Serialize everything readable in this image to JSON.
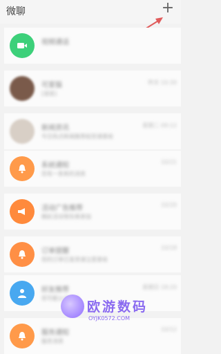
{
  "header": {
    "title": "微聊",
    "add_icon": "plus-icon",
    "add_label": "+"
  },
  "annotation": {
    "arrow_color": "#e05a5a"
  },
  "chat_list": [
    {
      "name": "视频通话",
      "preview": "",
      "time": "",
      "avatar_color": "#3dd07a",
      "avatar_icon": "video-icon"
    },
    {
      "name": "可爱猫",
      "preview": "[语音]",
      "time": "昨天 10:30",
      "avatar_color": "#7a5a4a",
      "avatar_icon": "photo-avatar"
    },
    {
      "name": "新闻资讯",
      "preview": "今日热点新闻推荐给您请查收",
      "time": "星期二 09:12",
      "avatar_color": "#d8cfc6",
      "avatar_icon": "photo-avatar"
    },
    {
      "name": "系统通知",
      "preview": "您有一条新的消息",
      "time": "10/21",
      "avatar_color": "#ff9a4a",
      "avatar_icon": "bell-icon"
    },
    {
      "name": "活动广告推荐",
      "preview": "精彩活动等你来参加",
      "time": "10/20",
      "avatar_color": "#ff8a3c",
      "avatar_icon": "megaphone-icon"
    },
    {
      "name": "订单提醒",
      "preview": "您的订单已发货请注意查收",
      "time": "10/18",
      "avatar_color": "#ff8f45",
      "avatar_icon": "bell-icon"
    },
    {
      "name": "好友推荐",
      "preview": "您可能认识的人",
      "time": "星期日 18:20",
      "avatar_color": "#48a8f0",
      "avatar_icon": "user-icon"
    },
    {
      "name": "服务通知",
      "preview": "服务消息",
      "time": "10/12",
      "avatar_color": "#ff9a4a",
      "avatar_icon": "bell-icon"
    }
  ],
  "watermark": {
    "text": "欧游数码",
    "url": "OYJK0572.COM",
    "logo_icon": "brand-logo"
  }
}
